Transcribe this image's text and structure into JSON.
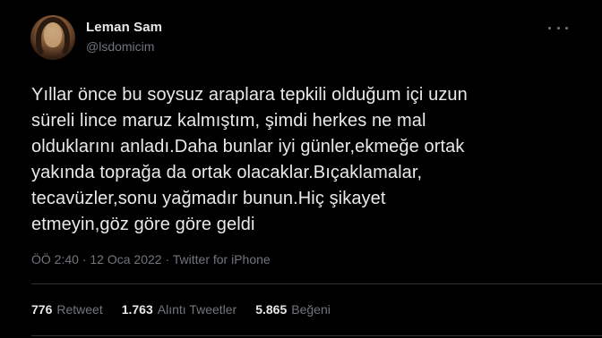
{
  "author": {
    "display_name": "Leman Sam",
    "handle": "@lsdomicim"
  },
  "tweet": {
    "text": "Yıllar önce bu soysuz araplara tepkili olduğum içi uzun\nsüreli lince maruz kalmıştım, şimdi herkes ne mal\nolduklarını anladı.Daha bunlar iyi günler,ekmeğe ortak\nyakında toprağa da ortak olacaklar.Bıçaklamalar,\ntecavüzler,sonu yağmadır bunun.Hiç şikayet\netmeyin,göz göre göre geldi",
    "time": "ÖÖ 2:40",
    "separator": "·",
    "date": "12 Oca 2022",
    "source": "Twitter for iPhone"
  },
  "stats": {
    "retweets_count": "776",
    "retweets_label": "Retweet",
    "quotes_count": "1.763",
    "quotes_label": "Alıntı Tweetler",
    "likes_count": "5.865",
    "likes_label": "Beğeni"
  },
  "icons": {
    "more": "more-horizontal-icon"
  },
  "colors": {
    "background": "#000000",
    "primary_text": "#e7e9ea",
    "secondary_text": "#71767b",
    "divider": "#2f3336"
  }
}
